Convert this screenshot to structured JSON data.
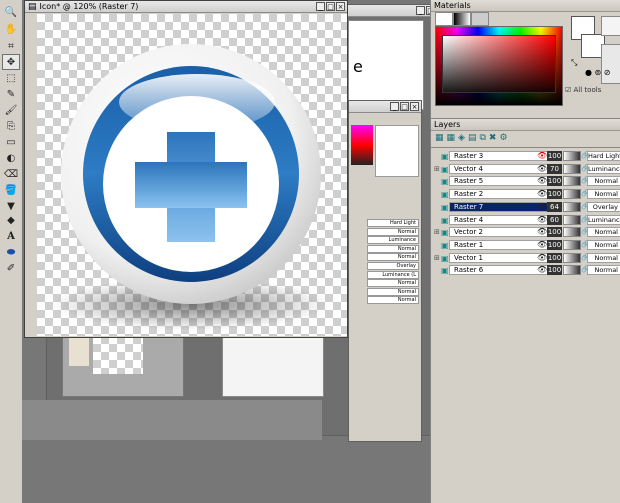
{
  "canvas_window": {
    "title": "Icon* @ 120% (Raster 7)",
    "buttons": [
      "_",
      "□",
      "×"
    ]
  },
  "materials": {
    "title": "Materials",
    "all_tools_label": "All tools",
    "colors": {
      "fg": "#ffffff",
      "bg": "#000000"
    }
  },
  "layers": {
    "title": "Layers",
    "rows": [
      {
        "name": "Raster 3",
        "opacity": "100",
        "blend": "Hard Light",
        "selected": false
      },
      {
        "name": "Vector 4",
        "opacity": "70",
        "blend": "Luminance",
        "selected": false
      },
      {
        "name": "Raster 5",
        "opacity": "100",
        "blend": "Normal",
        "selected": false
      },
      {
        "name": "Raster 2",
        "opacity": "100",
        "blend": "Normal",
        "selected": false
      },
      {
        "name": "Raster 7",
        "opacity": "64",
        "blend": "Overlay",
        "selected": true
      },
      {
        "name": "Raster 4",
        "opacity": "60",
        "blend": "Luminance (L",
        "selected": false
      },
      {
        "name": "Vector 2",
        "opacity": "100",
        "blend": "Normal",
        "selected": false
      },
      {
        "name": "Raster 1",
        "opacity": "100",
        "blend": "Normal",
        "selected": false
      },
      {
        "name": "Vector 1",
        "opacity": "100",
        "blend": "Normal",
        "selected": false
      },
      {
        "name": "Raster 6",
        "opacity": "100",
        "blend": "Normal",
        "selected": false
      }
    ]
  },
  "background_window": {
    "text_fragment": "e",
    "mini_blends": [
      "Hard Light",
      "Normal",
      "Luminance",
      "Normal",
      "Normal",
      "Overlay",
      "Luminance (L",
      "Normal",
      "Normal",
      "Normal"
    ]
  }
}
